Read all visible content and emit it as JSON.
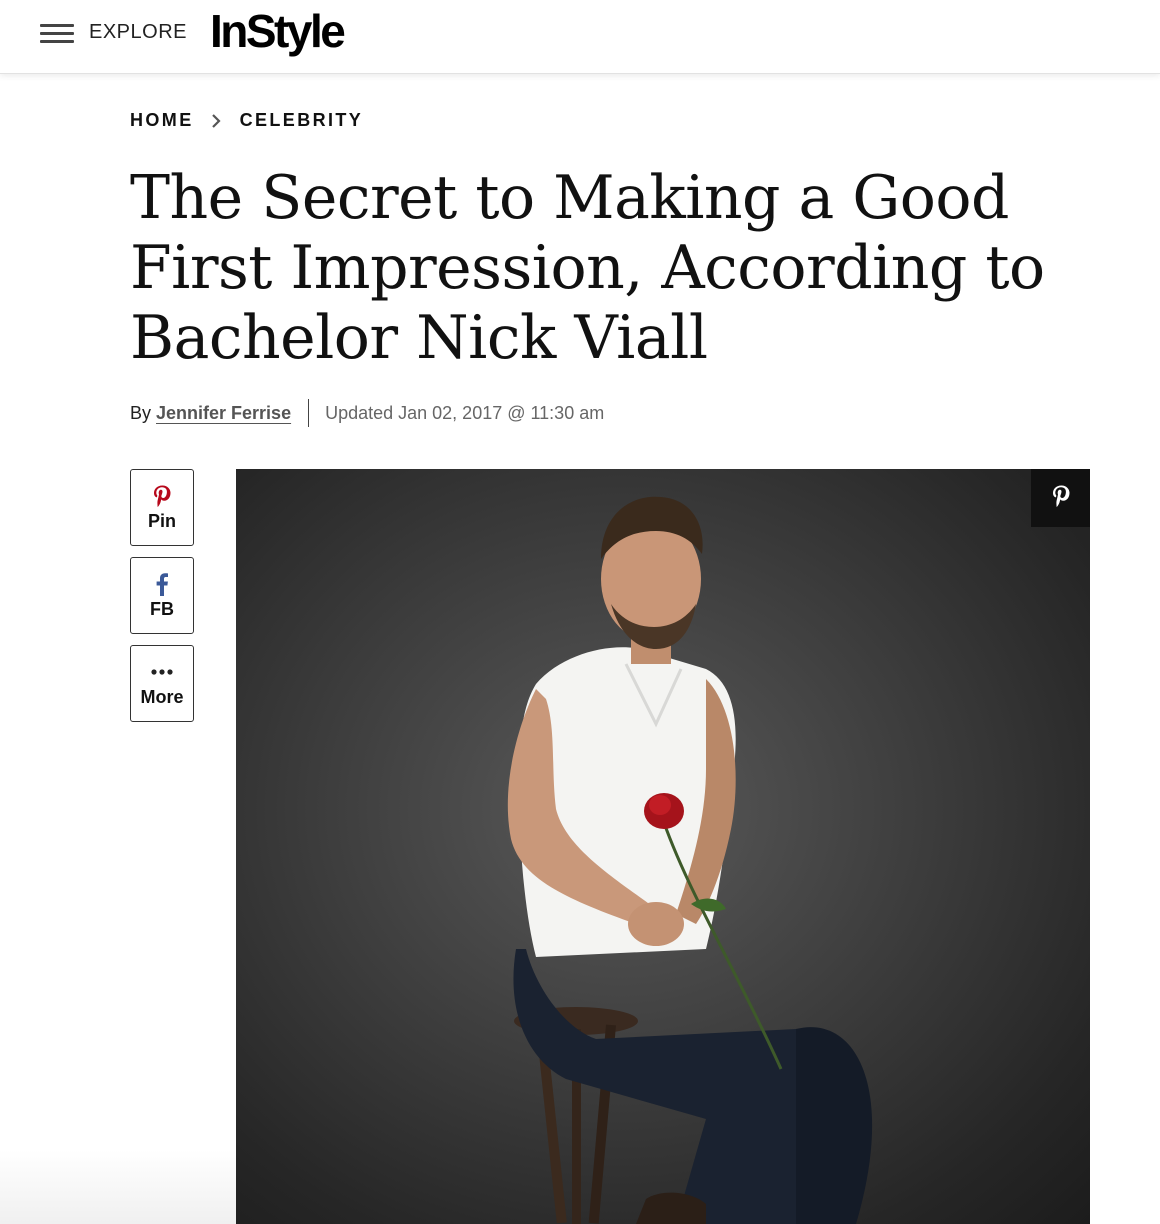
{
  "header": {
    "explore_label": "EXPLORE",
    "logo_text": "InStyle"
  },
  "breadcrumb": {
    "items": [
      "HOME",
      "CELEBRITY"
    ]
  },
  "article": {
    "title": "The Secret to Making a Good First Impression, According to Bachelor Nick Viall",
    "by_prefix": "By",
    "author": "Jennifer Ferrise",
    "updated": "Updated Jan 02, 2017 @ 11:30 am"
  },
  "share": {
    "pin_label": "Pin",
    "fb_label": "FB",
    "more_label": "More",
    "pin_icon": "pinterest-icon",
    "fb_icon": "facebook-icon",
    "more_icon": "ellipsis-icon"
  },
  "colors": {
    "pinterest": "#b7081b",
    "facebook": "#3b5998",
    "text": "#111111"
  }
}
